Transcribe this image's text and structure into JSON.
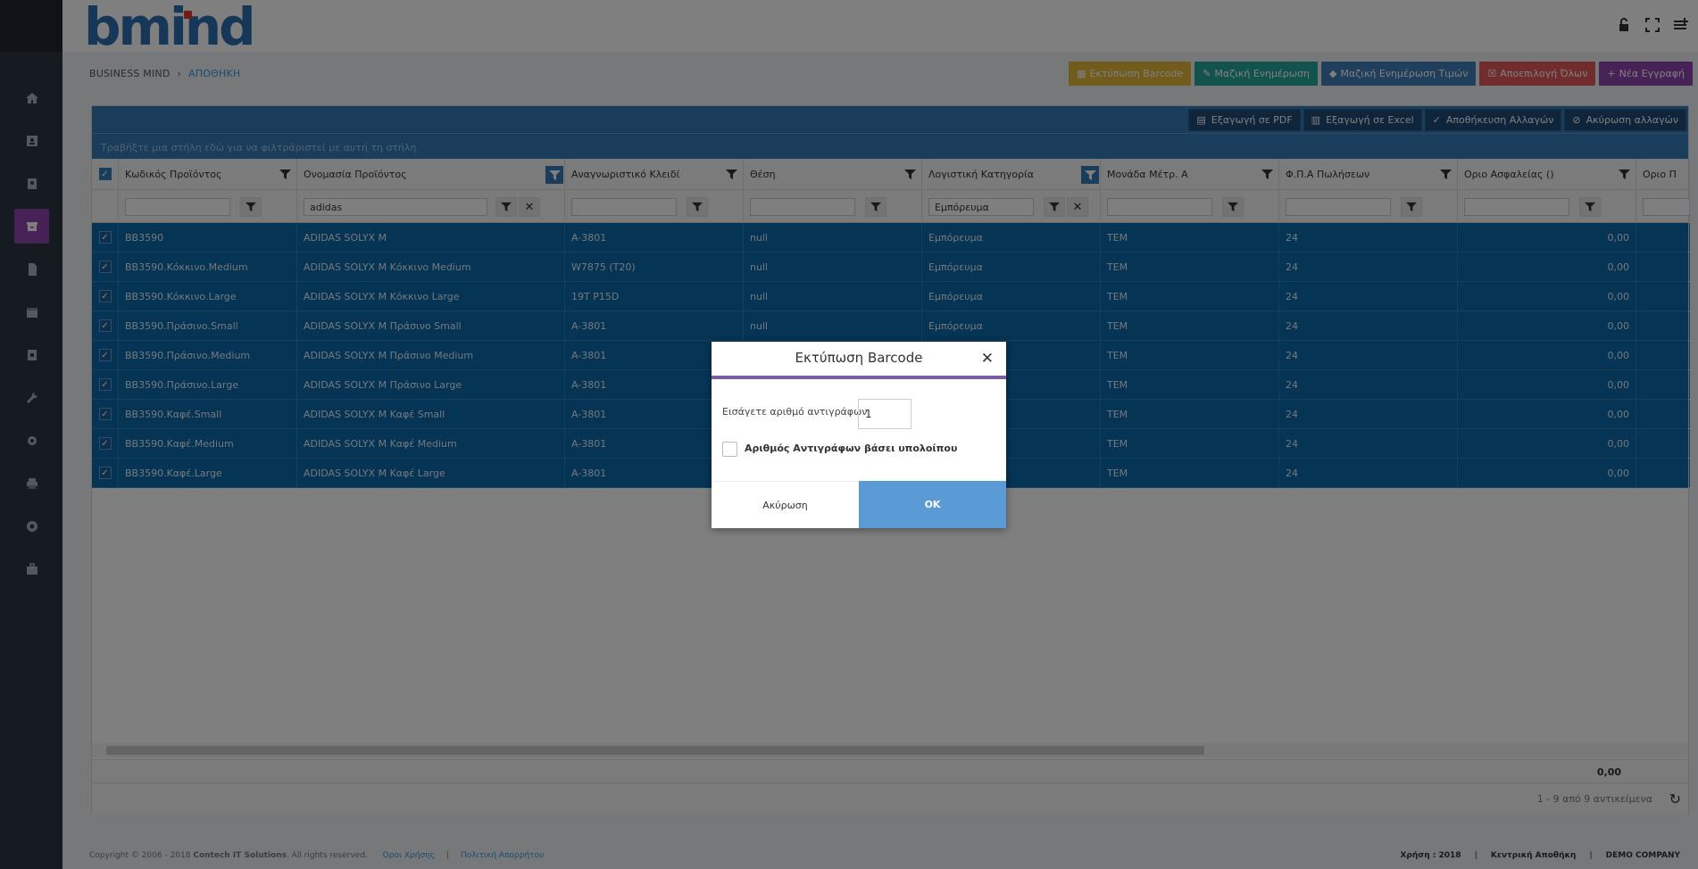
{
  "app": {
    "logo_text": "bmind"
  },
  "breadcrumb": {
    "root": "BUSINESS MIND",
    "current": "ΑΠΟΘΗΚΗ"
  },
  "actions": [
    {
      "label": "Εκτύπωση Barcode",
      "icon": "barcode-icon",
      "color": "#e3b93c"
    },
    {
      "label": "Μαζική Ενημέρωση",
      "icon": "edit-icon",
      "color": "#26a69a"
    },
    {
      "label": "Μαζική Ενημέρωση Τιμών",
      "icon": "tag-icon",
      "color": "#3f7fb8"
    },
    {
      "label": "Αποεπιλογή Όλων",
      "icon": "uncheck-icon",
      "color": "#e35b5a"
    },
    {
      "label": "Νέα Εγγραφή",
      "icon": "plus-icon",
      "color": "#8e44ad"
    }
  ],
  "toolbar": {
    "pdf": "Εξαγωγή σε PDF",
    "excel": "Εξαγωγή σε Excel",
    "save": "Αποθήκευση Αλλαγών",
    "cancel": "Ακύρωση αλλαγών"
  },
  "group_hint": "Τραβήξτε μια στήλη εδώ για να φιλτράριστεί με αυτή τη στήλη",
  "columns": [
    "Κωδικός Προϊόντος",
    "Ονομασία Προϊόντος",
    "Αναγνωριστικό Κλειδί",
    "Θέση",
    "Λογιστική Κατηγορία",
    "Μονάδα Μέτρ. Α",
    "Φ.Π.Α Πωλήσεων",
    "Οριο Ασφαλείας ()",
    "Οριο Π"
  ],
  "filters": {
    "name": "adidas",
    "category": "Εμπόρευμα"
  },
  "rows": [
    {
      "code": "BB3590",
      "name": "ADIDAS SOLYX M",
      "key": "A-3801",
      "pos": "null",
      "cat": "Εμπόρευμα",
      "unit": "ΤΕΜ",
      "vat": "24",
      "safety": "0,00"
    },
    {
      "code": "BB3590.Κόκκινο.Medium",
      "name": "ADIDAS SOLYX M Κόκκινο Medium",
      "key": "W7875 (T20)",
      "pos": "null",
      "cat": "Εμπόρευμα",
      "unit": "ΤΕΜ",
      "vat": "24",
      "safety": "0,00"
    },
    {
      "code": "BB3590.Κόκκινο.Large",
      "name": "ADIDAS SOLYX M Κόκκινο Large",
      "key": "19T P15D",
      "pos": "null",
      "cat": "Εμπόρευμα",
      "unit": "ΤΕΜ",
      "vat": "24",
      "safety": "0,00"
    },
    {
      "code": "BB3590.Πράσινο.Small",
      "name": "ADIDAS SOLYX M Πράσινο Small",
      "key": "A-3801",
      "pos": "null",
      "cat": "Εμπόρευμα",
      "unit": "ΤΕΜ",
      "vat": "24",
      "safety": "0,00"
    },
    {
      "code": "BB3590.Πράσινο.Medium",
      "name": "ADIDAS SOLYX M Πράσινο Medium",
      "key": "A-3801",
      "pos": "",
      "cat": "",
      "unit": "ΤΕΜ",
      "vat": "24",
      "safety": "0,00"
    },
    {
      "code": "BB3590.Πράσινο.Large",
      "name": "ADIDAS SOLYX M Πράσινο Large",
      "key": "A-3801",
      "pos": "",
      "cat": "",
      "unit": "ΤΕΜ",
      "vat": "24",
      "safety": "0,00"
    },
    {
      "code": "BB3590.Καφέ.Small",
      "name": "ADIDAS SOLYX M Καφέ Small",
      "key": "A-3801",
      "pos": "",
      "cat": "",
      "unit": "ΤΕΜ",
      "vat": "24",
      "safety": "0,00"
    },
    {
      "code": "BB3590.Καφέ.Medium",
      "name": "ADIDAS SOLYX M Καφέ Medium",
      "key": "A-3801",
      "pos": "",
      "cat": "",
      "unit": "ΤΕΜ",
      "vat": "24",
      "safety": "0,00"
    },
    {
      "code": "BB3590.Καφέ.Large",
      "name": "ADIDAS SOLYX M Καφέ Large",
      "key": "A-3801",
      "pos": "",
      "cat": "",
      "unit": "ΤΕΜ",
      "vat": "24",
      "safety": "0,00"
    }
  ],
  "footer_total": "0,00",
  "pager_text": "1 - 9 από 9 αντικείμενα",
  "page_footer": {
    "copyright": "Copyright © 2006 - 2018",
    "company": "Contech IT Solutions",
    "rights": ". All rights reserved.",
    "terms": "Οροι Χρήσης",
    "privacy": "Πολιτική Απορρήτου",
    "year": "Χρήση : 2018",
    "warehouse": "Κεντρική Αποθήκη",
    "demo": "DEMO COMPANY"
  },
  "modal": {
    "title": "Εκτύπωση Barcode",
    "copies_label": "Εισάγετε αριθμό αντιγράφων",
    "copies_value": "1",
    "checkbox_label": "Αριθμός Αντιγράφων βάσει υπολοίπου",
    "cancel": "Ακύρωση",
    "ok": "OK"
  },
  "sidebar_icons": [
    "home-icon",
    "id-card-icon",
    "contact-icon",
    "archive-icon",
    "document-icon",
    "calendar-icon",
    "phone-book-icon",
    "wrench-icon",
    "gear-icon",
    "printer-icon",
    "globe-icon",
    "briefcase-icon"
  ]
}
